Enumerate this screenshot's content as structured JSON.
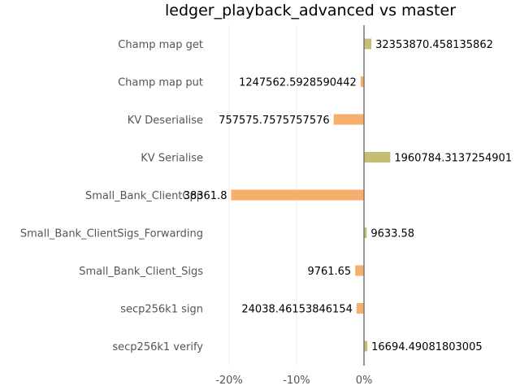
{
  "chart_data": {
    "type": "bar",
    "orientation": "horizontal",
    "title": "ledger_playback_advanced vs master",
    "xlabel": "",
    "ylabel": "",
    "xlim": [
      -0.23,
      0.023
    ],
    "x_ticks": [
      {
        "value": -0.2,
        "label": "-20%"
      },
      {
        "value": -0.1,
        "label": "-10%"
      },
      {
        "value": 0.0,
        "label": "0%"
      }
    ],
    "grid": true,
    "legend": "none",
    "colors": {
      "positive": "#c4bd72",
      "negative": "#f5ae6b",
      "zero_line": "#777777"
    },
    "categories": [
      "Champ map get",
      "Champ map put",
      "KV Deserialise",
      "KV Serialise",
      "Small_Bank_ClientCpp",
      "Small_Bank_ClientSigs_Forwarding",
      "Small_Bank_Client_Sigs",
      "secp256k1 sign",
      "secp256k1 verify"
    ],
    "values": [
      0.011,
      -0.005,
      -0.045,
      0.039,
      -0.197,
      0.004,
      -0.013,
      -0.011,
      0.005
    ],
    "data_labels": [
      "32353870.458135862",
      "1247562.5928590442",
      "757575.7575757576",
      "1960784.3137254901",
      "38361.8",
      "9633.58",
      "9761.65",
      "24038.46153846154",
      "16694.49081803005"
    ]
  }
}
